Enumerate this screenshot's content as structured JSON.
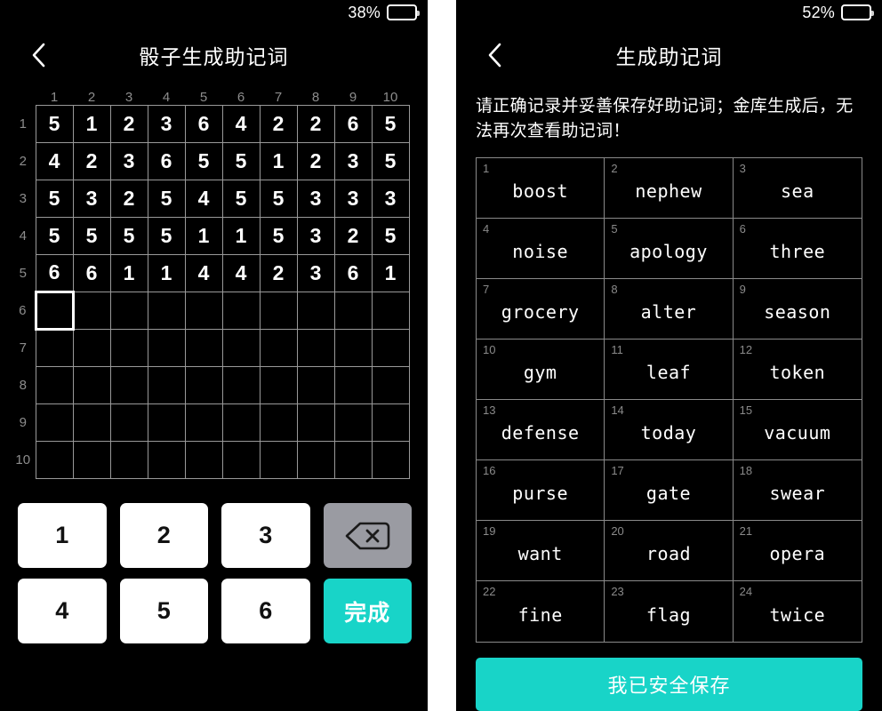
{
  "left_panel": {
    "status": {
      "battery_percent": "38%",
      "battery_level": 38
    },
    "nav": {
      "back_icon": "chevron-left-icon",
      "title": "骰子生成助记词"
    },
    "grid": {
      "col_headers": [
        "1",
        "2",
        "3",
        "4",
        "5",
        "6",
        "7",
        "8",
        "9",
        "10"
      ],
      "row_headers": [
        "1",
        "2",
        "3",
        "4",
        "5",
        "6",
        "7",
        "8",
        "9",
        "10"
      ],
      "rows": [
        [
          "5",
          "1",
          "2",
          "3",
          "6",
          "4",
          "2",
          "2",
          "6",
          "5"
        ],
        [
          "4",
          "2",
          "3",
          "6",
          "5",
          "5",
          "1",
          "2",
          "3",
          "5"
        ],
        [
          "5",
          "3",
          "2",
          "5",
          "4",
          "5",
          "5",
          "3",
          "3",
          "3"
        ],
        [
          "5",
          "5",
          "5",
          "5",
          "1",
          "1",
          "5",
          "3",
          "2",
          "5"
        ],
        [
          "6",
          "6",
          "1",
          "1",
          "4",
          "4",
          "2",
          "3",
          "6",
          "1"
        ],
        [
          "",
          "",
          "",
          "",
          "",
          "",
          "",
          "",
          "",
          ""
        ],
        [
          "",
          "",
          "",
          "",
          "",
          "",
          "",
          "",
          "",
          ""
        ],
        [
          "",
          "",
          "",
          "",
          "",
          "",
          "",
          "",
          "",
          ""
        ],
        [
          "",
          "",
          "",
          "",
          "",
          "",
          "",
          "",
          "",
          ""
        ],
        [
          "",
          "",
          "",
          "",
          "",
          "",
          "",
          "",
          "",
          ""
        ]
      ],
      "active_cell": {
        "row": 6,
        "col": 1
      }
    },
    "keypad": {
      "keys": [
        "1",
        "2",
        "3"
      ],
      "keys2": [
        "4",
        "5",
        "6"
      ],
      "backspace_icon": "backspace-icon",
      "done_label": "完成"
    }
  },
  "right_panel": {
    "status": {
      "battery_percent": "52%",
      "battery_level": 52
    },
    "nav": {
      "back_icon": "chevron-left-icon",
      "title": "生成助记词"
    },
    "notice": "请正确记录并妥善保存好助记词；金库生成后，无法再次查看助记词！",
    "mnemonic": {
      "words": [
        {
          "index": "1",
          "word": "boost"
        },
        {
          "index": "2",
          "word": "nephew"
        },
        {
          "index": "3",
          "word": "sea"
        },
        {
          "index": "4",
          "word": "noise"
        },
        {
          "index": "5",
          "word": "apology"
        },
        {
          "index": "6",
          "word": "three"
        },
        {
          "index": "7",
          "word": "grocery"
        },
        {
          "index": "8",
          "word": "alter"
        },
        {
          "index": "9",
          "word": "season"
        },
        {
          "index": "10",
          "word": "gym"
        },
        {
          "index": "11",
          "word": "leaf"
        },
        {
          "index": "12",
          "word": "token"
        },
        {
          "index": "13",
          "word": "defense"
        },
        {
          "index": "14",
          "word": "today"
        },
        {
          "index": "15",
          "word": "vacuum"
        },
        {
          "index": "16",
          "word": "purse"
        },
        {
          "index": "17",
          "word": "gate"
        },
        {
          "index": "18",
          "word": "swear"
        },
        {
          "index": "19",
          "word": "want"
        },
        {
          "index": "20",
          "word": "road"
        },
        {
          "index": "21",
          "word": "opera"
        },
        {
          "index": "22",
          "word": "fine"
        },
        {
          "index": "23",
          "word": "flag"
        },
        {
          "index": "24",
          "word": "twice"
        }
      ]
    },
    "save_label": "我已安全保存"
  },
  "colors": {
    "accent_teal": "#18d4c8",
    "background": "#000000",
    "key_white": "#ffffff",
    "key_gray": "#9a9ba2",
    "grid_line": "#999999",
    "muted_text": "#8a8a8a"
  }
}
